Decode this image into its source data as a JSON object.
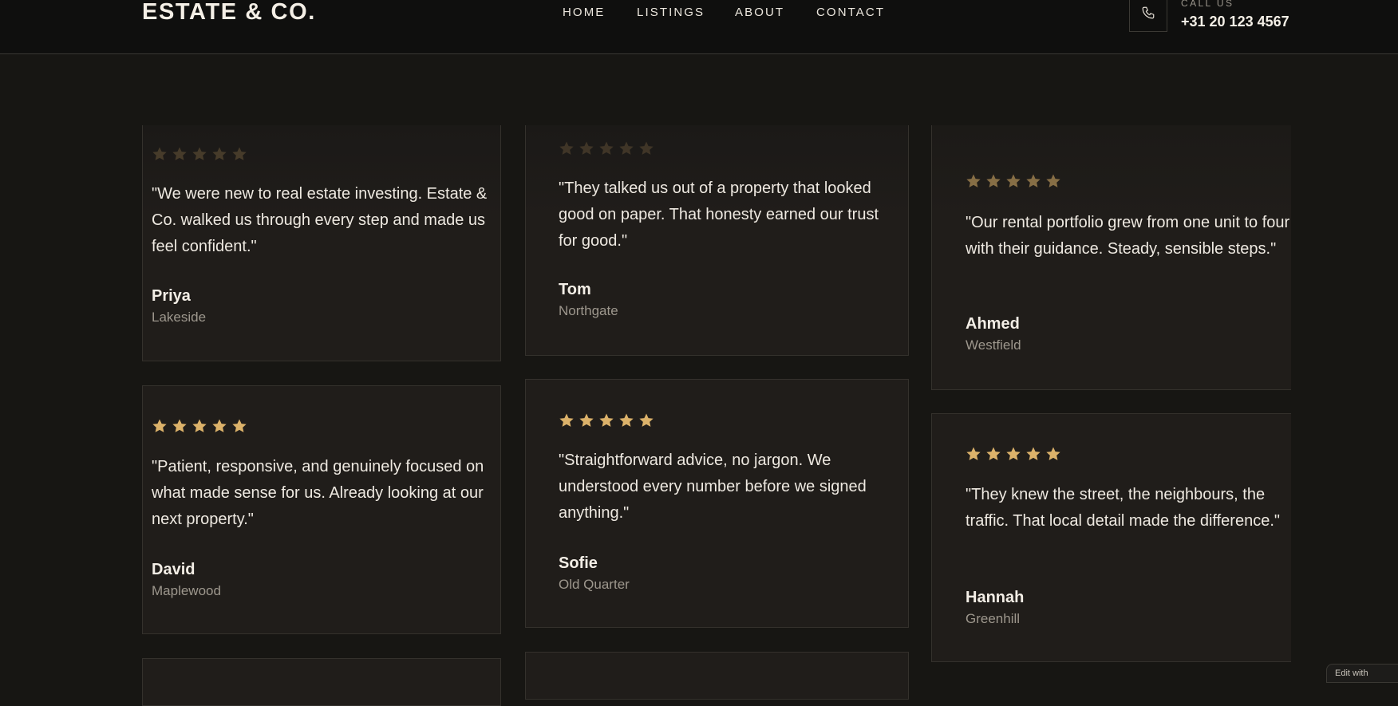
{
  "header": {
    "logo": "ESTATE & CO.",
    "nav": [
      "HOME",
      "LISTINGS",
      "ABOUT",
      "CONTACT"
    ],
    "call_label": "CALL US",
    "phone": "+31 20 123 4567",
    "phone_icon": "phone-icon"
  },
  "colors": {
    "background": "#171613",
    "header": "#0f0f0e",
    "card": "#201d1a",
    "star": "#dcb26a"
  },
  "testimonials": [
    {
      "rating": 5,
      "quote": "\"We were new to real estate investing. Estate & Co. walked us through every step and made us feel confident.\"",
      "name": "Priya",
      "location": "Lakeside"
    },
    {
      "rating": 5,
      "quote": "\"They talked us out of a property that looked good on paper. That honesty earned our trust for good.\"",
      "name": "Tom",
      "location": "Northgate"
    },
    {
      "rating": 5,
      "quote": "\"Our rental portfolio grew from one unit to four with their guidance. Steady, sensible steps.\"",
      "name": "Ahmed",
      "location": "Westfield"
    },
    {
      "rating": 5,
      "quote": "\"Patient, responsive, and genuinely focused on what made sense for us. Already looking at our next property.\"",
      "name": "David",
      "location": "Maplewood"
    },
    {
      "rating": 5,
      "quote": "\"Straightforward advice, no jargon. We understood every number before we signed anything.\"",
      "name": "Sofie",
      "location": "Old Quarter"
    },
    {
      "rating": 5,
      "quote": "\"They knew the street, the neighbours, the traffic. That local detail made the difference.\"",
      "name": "Hannah",
      "location": "Greenhill"
    }
  ],
  "badge": "Edit with"
}
